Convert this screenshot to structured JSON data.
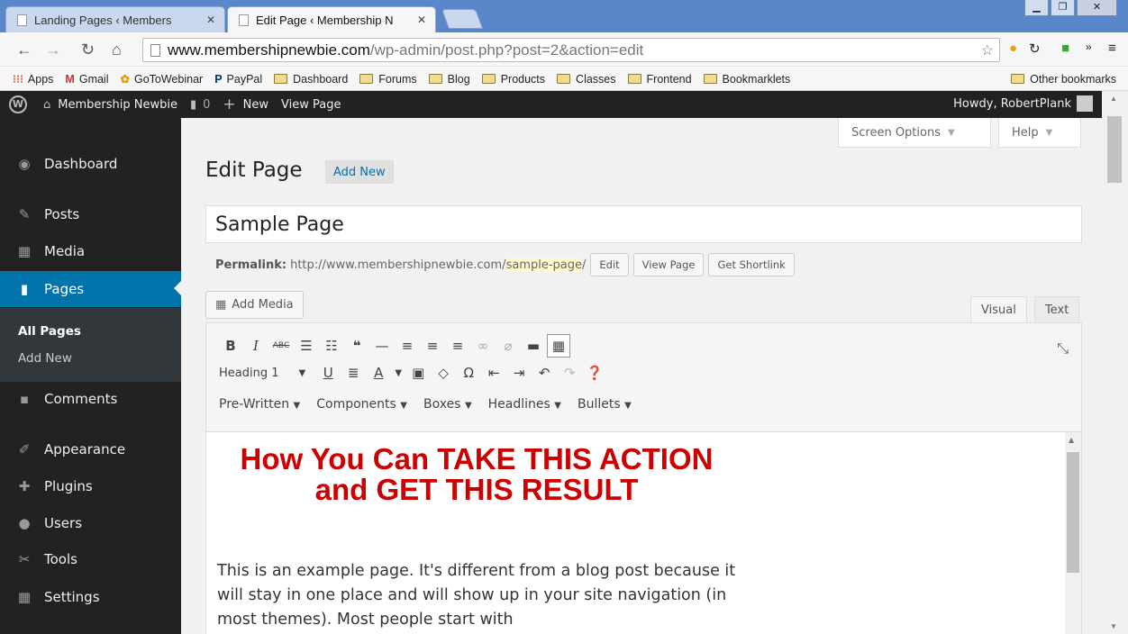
{
  "browser": {
    "tabs": [
      {
        "label": "Landing Pages ‹ Members"
      },
      {
        "label": "Edit Page ‹ Membership N"
      }
    ],
    "url_host": "www.membershipnewbie.com",
    "url_path": "/wp-admin/post.php?post=2&action=edit",
    "bookmarks": [
      "Apps",
      "Gmail",
      "GoToWebinar",
      "PayPal",
      "Dashboard",
      "Forums",
      "Blog",
      "Products",
      "Classes",
      "Frontend",
      "Bookmarklets"
    ],
    "other_bookmarks": "Other bookmarks"
  },
  "adminbar": {
    "site_name": "Membership Newbie",
    "comments_count": "0",
    "new_label": "New",
    "view_page": "View Page",
    "howdy": "Howdy, RobertPlank"
  },
  "sidebar": {
    "items": [
      {
        "label": "Dashboard",
        "icon": "dashboard-icon"
      },
      {
        "label": "Posts",
        "icon": "pin-icon"
      },
      {
        "label": "Media",
        "icon": "media-icon"
      },
      {
        "label": "Pages",
        "icon": "pages-icon"
      },
      {
        "label": "Comments",
        "icon": "comment-icon"
      },
      {
        "label": "Appearance",
        "icon": "brush-icon"
      },
      {
        "label": "Plugins",
        "icon": "plugin-icon"
      },
      {
        "label": "Users",
        "icon": "user-icon"
      },
      {
        "label": "Tools",
        "icon": "wrench-icon"
      },
      {
        "label": "Settings",
        "icon": "settings-icon"
      }
    ],
    "submenu": [
      "All Pages",
      "Add New"
    ]
  },
  "content": {
    "screen_options": "Screen Options",
    "help": "Help",
    "heading": "Edit Page",
    "add_new": "Add New",
    "title_value": "Sample Page",
    "permalink_label": "Permalink:",
    "permalink_base": "http://www.membershipnewbie.com/",
    "permalink_slug": "sample-page",
    "permalink_trail": "/",
    "permalink_buttons": [
      "Edit",
      "View Page",
      "Get Shortlink"
    ],
    "add_media": "Add Media",
    "editor_tabs": [
      "Visual",
      "Text"
    ],
    "format_select": "Heading 1",
    "menus": [
      "Pre-Written",
      "Components",
      "Boxes",
      "Headlines",
      "Bullets"
    ],
    "headline": "How You Can TAKE THIS ACTION and GET THIS RESULT",
    "paragraph": "This is an example page. It's different from a blog post because it will stay in one place and will show up in your site navigation (in most themes). Most people start with"
  },
  "colors": {
    "wp_dark": "#222222",
    "wp_accent": "#0073aa",
    "headline_red": "#cc0000"
  }
}
